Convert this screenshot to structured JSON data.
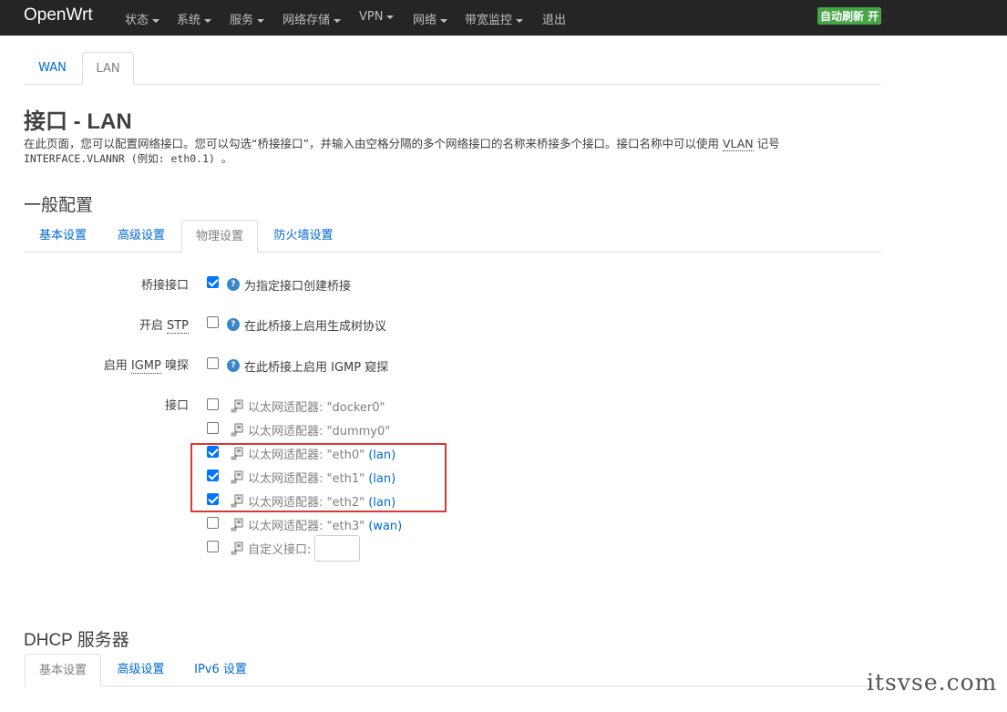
{
  "navbar": {
    "brand": "OpenWrt",
    "items": [
      {
        "label": "状态"
      },
      {
        "label": "系统"
      },
      {
        "label": "服务"
      },
      {
        "label": "网络存储"
      },
      {
        "label": "VPN"
      },
      {
        "label": "网络"
      },
      {
        "label": "带宽监控"
      },
      {
        "label": "退出"
      }
    ],
    "refresh_badge": "自动刷新 开"
  },
  "top_tabs": [
    {
      "label": "WAN",
      "active": false
    },
    {
      "label": "LAN",
      "active": true
    }
  ],
  "page": {
    "title": "接口 - LAN",
    "description_part1": "在此页面，您可以配置网络接口。您可以勾选“桥接接口”，并输入由空格分隔的多个网络接口的名称来桥接多个接口。接口名称中可以使用 ",
    "description_abbr": "VLAN",
    "description_part2": " 记号",
    "description_line2": "INTERFACE.VLANNR (例如: eth0.1) 。"
  },
  "general_config": {
    "title": "一般配置",
    "tabs": [
      {
        "label": "基本设置",
        "active": false
      },
      {
        "label": "高级设置",
        "active": false
      },
      {
        "label": "物理设置",
        "active": true
      },
      {
        "label": "防火墙设置",
        "active": false
      }
    ],
    "fields": {
      "bridge": {
        "label": "桥接接口",
        "checked": true,
        "help": "为指定接口创建桥接"
      },
      "stp": {
        "label_prefix": "开启 ",
        "label_abbr": "STP",
        "checked": false,
        "help": "在此桥接上启用生成树协议"
      },
      "igmp": {
        "label_prefix": "启用 ",
        "label_abbr": "IGMP",
        "label_suffix": " 嗅探",
        "checked": false,
        "help": "在此桥接上启用 IGMP 窥探"
      },
      "interfaces": {
        "label": "接口",
        "items": [
          {
            "text": "以太网适配器: \"docker0\"",
            "zone": "",
            "checked": false
          },
          {
            "text": "以太网适配器: \"dummy0\"",
            "zone": "",
            "checked": false
          },
          {
            "text": "以太网适配器: \"eth0\" ",
            "zone": "(lan)",
            "checked": true
          },
          {
            "text": "以太网适配器: \"eth1\" ",
            "zone": "(lan)",
            "checked": true
          },
          {
            "text": "以太网适配器: \"eth2\" ",
            "zone": "(lan)",
            "checked": true
          },
          {
            "text": "以太网适配器: \"eth3\" ",
            "zone": "(wan)",
            "checked": false
          },
          {
            "text": "自定义接口:",
            "zone": "",
            "checked": false
          }
        ],
        "custom_value": ""
      }
    }
  },
  "dhcp": {
    "title": "DHCP 服务器",
    "tabs": [
      {
        "label": "基本设置",
        "active": true
      },
      {
        "label": "高级设置",
        "active": false
      },
      {
        "label": "IPv6 设置",
        "active": false
      }
    ]
  },
  "watermark": "itsvse.com",
  "colors": {
    "navbar": "#252525",
    "link": "#0069d6",
    "badge": "#46a546",
    "highlight": "#d9383a"
  }
}
